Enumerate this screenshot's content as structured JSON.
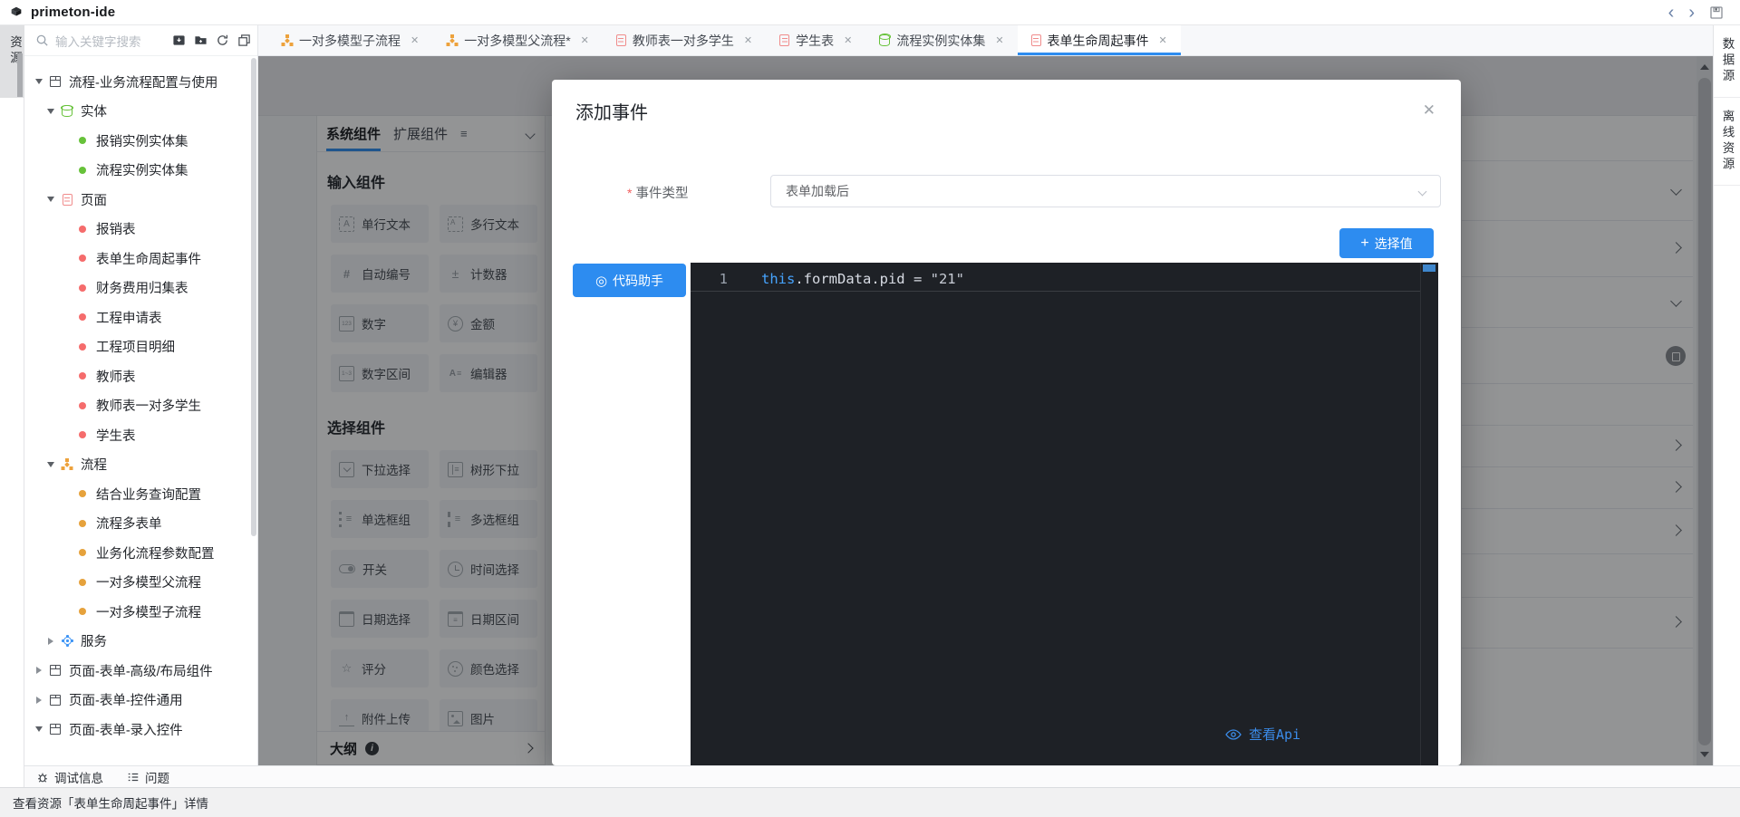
{
  "titlebar": {
    "app_title": "primeton-ide"
  },
  "icons": {
    "logo": "primeton-mark",
    "back_glyph": "‹",
    "forward_glyph": "›",
    "save": "floppy-disk",
    "search": "magnifier",
    "import_resource": "dark-box-arrow",
    "new_folder": "folder-plus",
    "refresh": "circular-arrow",
    "collapse_panels": "overlapping-squares",
    "close_glyph": "✕",
    "menu_glyph": "≡",
    "plus_glyph": "+",
    "code_helper_glyph": "◎",
    "outline_info_glyph": "i",
    "debug": "bug",
    "problems": "list-lines",
    "view_api_eye": "eye-outline"
  },
  "left_rail": {
    "active_tab": "资源"
  },
  "right_rail": {
    "tabs": [
      {
        "label": "数据源"
      },
      {
        "label": "离线资源"
      }
    ]
  },
  "sidebar": {
    "search_placeholder": "输入关键字搜索",
    "tree": [
      {
        "lv": "lv0",
        "arrow": "arr-down",
        "icon": "ic-package",
        "label": "流程-业务流程配置与使用"
      },
      {
        "lv": "lv1",
        "arrow": "arr-down",
        "icon": "ic-entity",
        "label": "实体"
      },
      {
        "lv": "lv2",
        "arrow": "arr-none",
        "icon": "ic-dot-green",
        "label": "报销实例实体集"
      },
      {
        "lv": "lv2",
        "arrow": "arr-none",
        "icon": "ic-dot-green",
        "label": "流程实例实体集"
      },
      {
        "lv": "lv1",
        "arrow": "arr-down",
        "icon": "ic-page",
        "label": "页面"
      },
      {
        "lv": "lv2",
        "arrow": "arr-none",
        "icon": "ic-dot-red",
        "label": "报销表"
      },
      {
        "lv": "lv2",
        "arrow": "arr-none",
        "icon": "ic-dot-red",
        "label": "表单生命周起事件"
      },
      {
        "lv": "lv2",
        "arrow": "arr-none",
        "icon": "ic-dot-red",
        "label": "财务费用归集表"
      },
      {
        "lv": "lv2",
        "arrow": "arr-none",
        "icon": "ic-dot-red",
        "label": "工程申请表"
      },
      {
        "lv": "lv2",
        "arrow": "arr-none",
        "icon": "ic-dot-red",
        "label": "工程项目明细"
      },
      {
        "lv": "lv2",
        "arrow": "arr-none",
        "icon": "ic-dot-red",
        "label": "教师表"
      },
      {
        "lv": "lv2",
        "arrow": "arr-none",
        "icon": "ic-dot-red",
        "label": "教师表一对多学生"
      },
      {
        "lv": "lv2",
        "arrow": "arr-none",
        "icon": "ic-dot-red",
        "label": "学生表"
      },
      {
        "lv": "lv1",
        "arrow": "arr-down",
        "icon": "ic-flow",
        "label": "流程"
      },
      {
        "lv": "lv2",
        "arrow": "arr-none",
        "icon": "ic-dot-orange",
        "label": "结合业务查询配置"
      },
      {
        "lv": "lv2",
        "arrow": "arr-none",
        "icon": "ic-dot-orange",
        "label": "流程多表单"
      },
      {
        "lv": "lv2",
        "arrow": "arr-none",
        "icon": "ic-dot-orange",
        "label": "业务化流程参数配置"
      },
      {
        "lv": "lv2",
        "arrow": "arr-none",
        "icon": "ic-dot-orange",
        "label": "一对多模型父流程"
      },
      {
        "lv": "lv2",
        "arrow": "arr-none",
        "icon": "ic-dot-orange",
        "label": "一对多模型子流程"
      },
      {
        "lv": "lv1",
        "arrow": "arr-right",
        "icon": "ic-service",
        "label": "服务"
      },
      {
        "lv": "lv0",
        "arrow": "arr-right",
        "icon": "ic-package",
        "label": "页面-表单-高级/布局组件"
      },
      {
        "lv": "lv0",
        "arrow": "arr-right",
        "icon": "ic-package",
        "label": "页面-表单-控件通用"
      },
      {
        "lv": "lv0",
        "arrow": "arr-down",
        "icon": "ic-package",
        "label": "页面-表单-录入控件"
      }
    ]
  },
  "tabs": [
    {
      "icon": "ic-flow",
      "label": "一对多模型子流程"
    },
    {
      "icon": "ic-flow",
      "label": "一对多模型父流程*"
    },
    {
      "icon": "ic-page",
      "label": "教师表一对多学生"
    },
    {
      "icon": "ic-page",
      "label": "学生表"
    },
    {
      "icon": "ic-entity",
      "label": "流程实例实体集"
    },
    {
      "icon": "ic-page",
      "label": "表单生命周起事件",
      "state": "active"
    }
  ],
  "palette": {
    "tabs": [
      {
        "label": "系统组件",
        "state": "active"
      },
      {
        "label": "扩展组件"
      }
    ],
    "section_input": "输入组件",
    "input_components": [
      {
        "icon": "i-text",
        "label": "单行文本"
      },
      {
        "icon": "i-textarea",
        "label": "多行文本"
      },
      {
        "icon": "i-autonum",
        "label": "自动编号"
      },
      {
        "icon": "i-counter",
        "label": "计数器"
      },
      {
        "icon": "i-number",
        "label": "数字"
      },
      {
        "icon": "i-money",
        "label": "金额"
      },
      {
        "icon": "i-range",
        "label": "数字区间"
      },
      {
        "icon": "i-editor",
        "label": "编辑器"
      }
    ],
    "section_select": "选择组件",
    "select_components": [
      {
        "icon": "i-select",
        "label": "下拉选择"
      },
      {
        "icon": "i-treeselect",
        "label": "树形下拉"
      },
      {
        "icon": "i-radio",
        "label": "单选框组"
      },
      {
        "icon": "i-checkbox",
        "label": "多选框组"
      },
      {
        "icon": "i-switch",
        "label": "开关"
      },
      {
        "icon": "i-time",
        "label": "时间选择"
      },
      {
        "icon": "i-date",
        "label": "日期选择"
      },
      {
        "icon": "i-daterange",
        "label": "日期区间"
      },
      {
        "icon": "i-rate",
        "label": "评分"
      },
      {
        "icon": "i-color",
        "label": "颜色选择"
      },
      {
        "icon": "i-upload",
        "label": "附件上传"
      },
      {
        "icon": "i-image",
        "label": "图片"
      }
    ],
    "outline": {
      "label": "大纲"
    }
  },
  "props_rows": [
    {
      "kind": "r-a"
    },
    {
      "kind": "r-b"
    },
    {
      "kind": "r-c"
    },
    {
      "kind": "r-d"
    },
    {
      "kind": "r-e"
    },
    {
      "kind": "r-f"
    },
    {
      "kind": "r-g"
    },
    {
      "kind": "r-h"
    },
    {
      "kind": "r-i"
    },
    {
      "kind": "r-j"
    },
    {
      "kind": "r-k"
    },
    {
      "kind": "r-l"
    }
  ],
  "modal": {
    "title": "添加事件",
    "field": {
      "required_mark": "*",
      "label": "事件类型",
      "value": "表单加载后"
    },
    "select_value_button": {
      "label": "选择值"
    },
    "code_helper_button": {
      "label": "代码助手"
    },
    "editor": {
      "line_number": "1",
      "code_keyword": "this",
      "code_expression": ".formData.pid = ",
      "code_string": "\"21\""
    },
    "view_api_label": "查看Api"
  },
  "toolbar": {
    "debug_label": "调试信息",
    "problems_label": "问题"
  },
  "statusbar": {
    "text": "查看资源「表单生命周起事件」详情"
  },
  "colors": {
    "accent_blue": "#2d8cf0",
    "service_blue": "#409eff",
    "entity_green": "#67c23a",
    "page_red": "#f56c6c",
    "flow_orange": "#e6a23c",
    "editor_bg": "#1e2126",
    "dim_overlay": "rgba(15,17,20,0.45)"
  }
}
